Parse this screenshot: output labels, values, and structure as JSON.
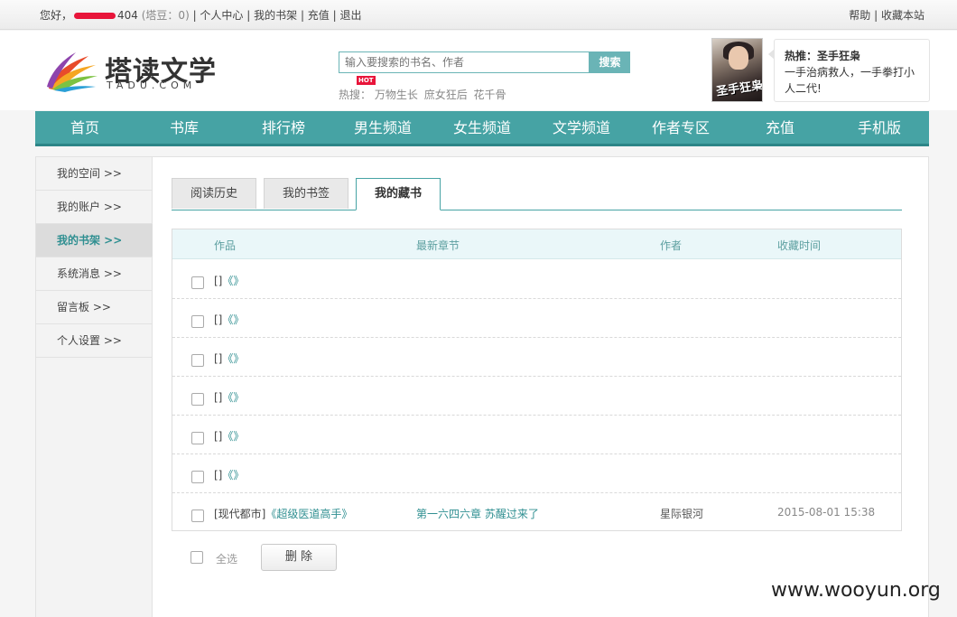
{
  "topbar": {
    "greeting": "您好，",
    "username_visible": "404",
    "coins": "(塔豆：0)",
    "links": [
      "个人中心",
      "我的书架",
      "充值",
      "退出"
    ],
    "right_links": [
      "帮助",
      "收藏本站"
    ]
  },
  "header": {
    "logo_cn": "塔读文学",
    "logo_en": "TADU.COM",
    "search_placeholder": "输入要搜索的书名、作者",
    "search_button": "搜索",
    "hot_label": "热搜：",
    "hot_tag": "HOT",
    "hot_keywords": [
      "万物生长",
      "庶女狂后",
      "花千骨"
    ],
    "promo_title": "热推：圣手狂枭",
    "promo_desc": "一手治病救人，一手拳打小人二代!",
    "promo_cover_text": "圣手狂枭"
  },
  "nav": [
    "首页",
    "书库",
    "排行榜",
    "男生频道",
    "女生频道",
    "文学频道",
    "作者专区",
    "充值",
    "手机版"
  ],
  "sidebar": [
    {
      "label": "我的空间 >>",
      "active": false
    },
    {
      "label": "我的账户 >>",
      "active": false
    },
    {
      "label": "我的书架 >>",
      "active": true
    },
    {
      "label": "系统消息 >>",
      "active": false
    },
    {
      "label": "留言板 >>",
      "active": false
    },
    {
      "label": "个人设置 >>",
      "active": false
    }
  ],
  "tabs": [
    {
      "label": "阅读历史",
      "active": false
    },
    {
      "label": "我的书签",
      "active": false
    },
    {
      "label": "我的藏书",
      "active": true
    }
  ],
  "table": {
    "headers": [
      "作品",
      "最新章节",
      "作者",
      "收藏时间"
    ],
    "rows": [
      {
        "category": "[]",
        "book": "《》",
        "chapter": "",
        "author": "",
        "time": ""
      },
      {
        "category": "[]",
        "book": "《》",
        "chapter": "",
        "author": "",
        "time": ""
      },
      {
        "category": "[]",
        "book": "《》",
        "chapter": "",
        "author": "",
        "time": ""
      },
      {
        "category": "[]",
        "book": "《》",
        "chapter": "",
        "author": "",
        "time": ""
      },
      {
        "category": "[]",
        "book": "《》",
        "chapter": "",
        "author": "",
        "time": ""
      },
      {
        "category": "[]",
        "book": "《》",
        "chapter": "",
        "author": "",
        "time": ""
      },
      {
        "category": "[现代都市]",
        "book": "《超级医道高手》",
        "chapter": "第一六四六章 苏醒过来了",
        "author": "星际银河",
        "time": "2015-08-01 15:38"
      }
    ]
  },
  "footer": {
    "select_all": "全选",
    "delete_button": "删 除"
  },
  "watermark": "www.wooyun.org",
  "colors": {
    "accent": "#46a3a4",
    "link": "#2f8f91",
    "hot_red": "#e8153a"
  }
}
